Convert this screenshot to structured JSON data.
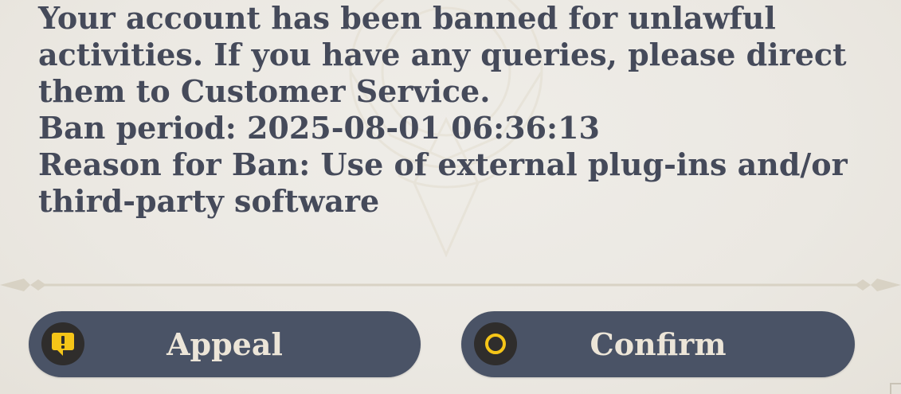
{
  "dialog": {
    "message_lines": [
      "Your account has been banned for unlawful",
      "activities. If you have any queries, please direct",
      "them to Customer Service.",
      "Ban period: 2025-08-01 06:36:13",
      "Reason for Ban: Use of external plug-ins and/or",
      "third-party software"
    ]
  },
  "buttons": {
    "appeal": {
      "label": "Appeal",
      "icon": "alert-icon"
    },
    "confirm": {
      "label": "Confirm",
      "icon": "circle-o-icon"
    }
  },
  "colors": {
    "background": "#ece9e3",
    "text": "#454a5a",
    "button_bg": "#4a5366",
    "button_text": "#ece5d8",
    "icon_bg": "#2f2d2c",
    "accent_yellow": "#f5c518"
  }
}
